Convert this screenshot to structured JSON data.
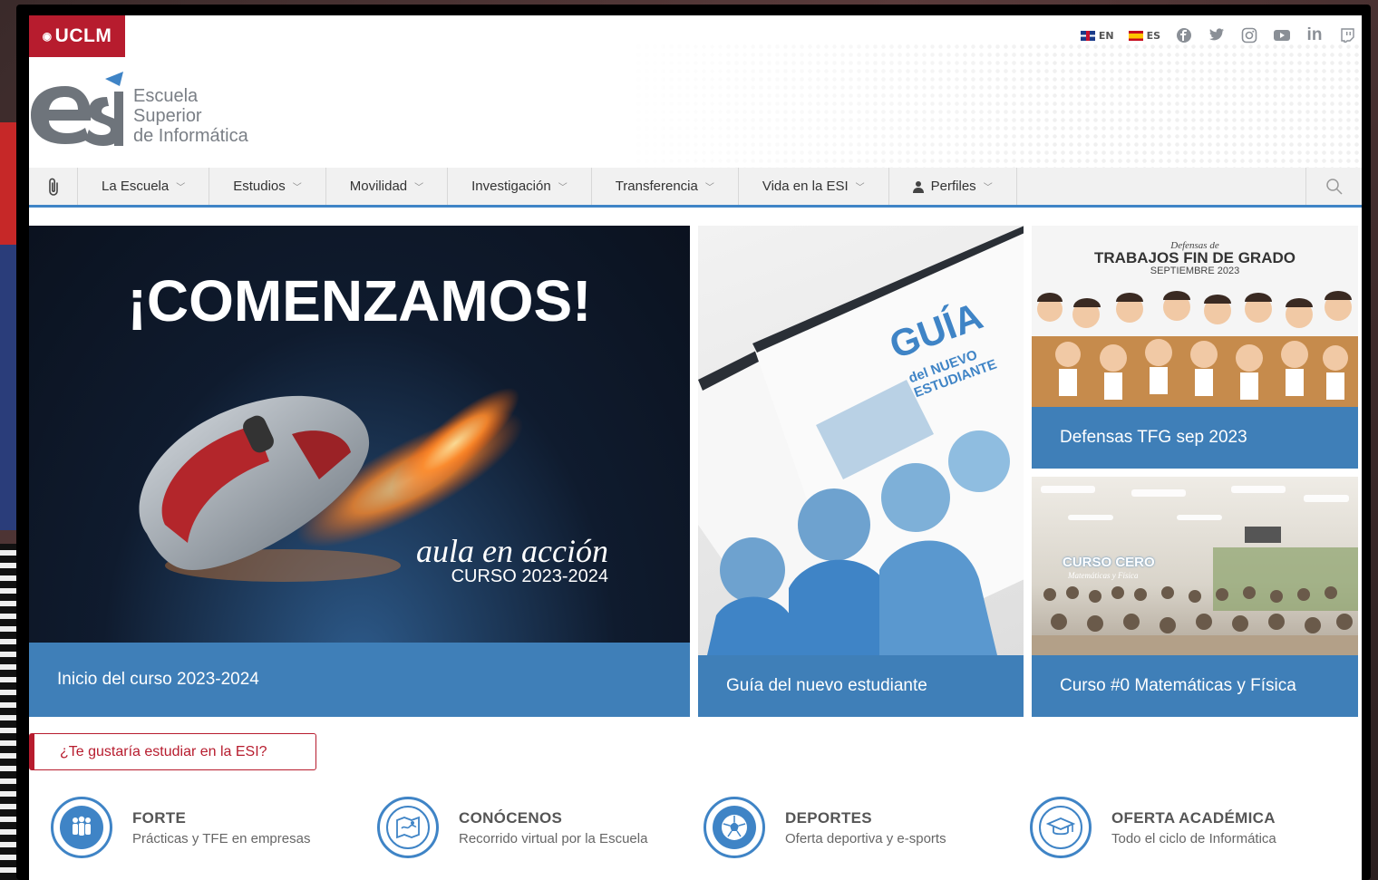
{
  "brand": {
    "uclm": "UCLM",
    "esi_lines": [
      "Escuela",
      "Superior",
      "de Informática"
    ]
  },
  "topbar": {
    "lang_en": "EN",
    "lang_es": "ES",
    "social_icons": [
      "facebook-icon",
      "twitter-icon",
      "instagram-icon",
      "youtube-icon",
      "linkedin-icon",
      "twitch-icon"
    ]
  },
  "nav": {
    "items": [
      "La Escuela",
      "Estudios",
      "Movilidad",
      "Investigación",
      "Transferencia",
      "Vida en la ESI",
      "Perfiles"
    ]
  },
  "cards": {
    "main": {
      "headline": "¡COMENZAMOS!",
      "tagline": "aula en acción",
      "course": "CURSO 2023-2024",
      "caption": "Inicio del curso 2023-2024"
    },
    "guide": {
      "cover_title": "GUÍA",
      "cover_sub": "del NUEVO ESTUDIANTE",
      "caption": "Guía del nuevo estudiante"
    },
    "tfg": {
      "sub1": "Defensas de",
      "sub2": "TRABAJOS FIN DE GRADO",
      "sub3": "SEPTIEMBRE 2023",
      "caption": "Defensas TFG sep 2023"
    },
    "curso0": {
      "banner": "CURSO CERO",
      "banner_sub": "Matemáticas y Física",
      "caption": "Curso #0 Matemáticas y Física"
    }
  },
  "cta": {
    "label": "¿Te gustaría estudiar en la ESI?"
  },
  "features": [
    {
      "title": "FORTE",
      "subtitle": "Prácticas y TFE en empresas",
      "icon": "people-icon"
    },
    {
      "title": "CONÓCENOS",
      "subtitle": "Recorrido virtual por la Escuela",
      "icon": "map-icon"
    },
    {
      "title": "DEPORTES",
      "subtitle": "Oferta deportiva y e-sports",
      "icon": "football-icon"
    },
    {
      "title": "OFERTA ACADÉMICA",
      "subtitle": "Todo el ciclo de Informática",
      "icon": "graduation-cap-icon"
    }
  ],
  "colors": {
    "accent": "#3f84c6",
    "brand_red": "#b71c2e",
    "caption_blue": "#3f7fb8"
  }
}
